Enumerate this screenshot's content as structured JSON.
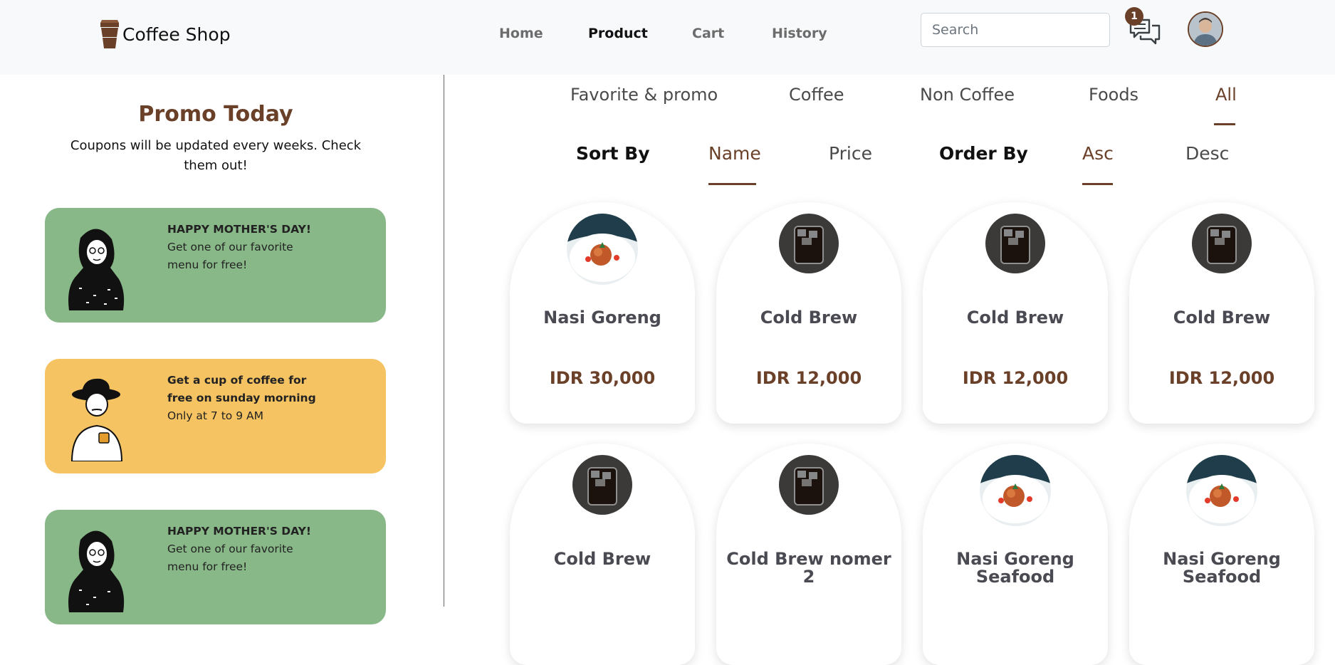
{
  "header": {
    "brand": "Coffee Shop",
    "nav": [
      {
        "label": "Home",
        "active": false
      },
      {
        "label": "Product",
        "active": true
      },
      {
        "label": "Cart",
        "active": false
      },
      {
        "label": "History",
        "active": false
      }
    ],
    "search_placeholder": "Search",
    "chat_badge": "1"
  },
  "promo": {
    "title": "Promo Today",
    "subtitle": "Coupons will be updated every weeks. Check them out!",
    "coupons": [
      {
        "headline": "HAPPY MOTHER'S DAY!",
        "body": "Get one of our favorite menu for free!",
        "color": "#88b788"
      },
      {
        "headline": "Get a cup of coffee for free on sunday morning",
        "body": "Only at 7 to 9 AM",
        "color": "#f5c361"
      },
      {
        "headline": "HAPPY MOTHER'S DAY!",
        "body": "Get one of our favorite menu for free!",
        "color": "#88b788"
      }
    ]
  },
  "categories": [
    {
      "label": "Favorite & promo",
      "active": false
    },
    {
      "label": "Coffee",
      "active": false
    },
    {
      "label": "Non Coffee",
      "active": false
    },
    {
      "label": "Foods",
      "active": false
    },
    {
      "label": "All",
      "active": true
    }
  ],
  "sorting": {
    "sort_label": "Sort By",
    "sort_options": [
      {
        "label": "Name",
        "active": true
      },
      {
        "label": "Price",
        "active": false
      }
    ],
    "order_label": "Order By",
    "order_options": [
      {
        "label": "Asc",
        "active": true
      },
      {
        "label": "Desc",
        "active": false
      }
    ]
  },
  "products": [
    {
      "name": "Nasi Goreng",
      "price": "IDR 30,000",
      "image": "pasta"
    },
    {
      "name": "Cold Brew",
      "price": "IDR 12,000",
      "image": "cold-brew"
    },
    {
      "name": "Cold Brew",
      "price": "IDR 12,000",
      "image": "cold-brew"
    },
    {
      "name": "Cold Brew",
      "price": "IDR 12,000",
      "image": "cold-brew"
    },
    {
      "name": "Cold Brew",
      "price": "",
      "image": "cold-brew"
    },
    {
      "name": "Cold Brew nomer 2",
      "price": "",
      "image": "cold-brew"
    },
    {
      "name": "Nasi Goreng Seafood",
      "price": "",
      "image": "pasta"
    },
    {
      "name": "Nasi Goreng Seafood",
      "price": "",
      "image": "pasta"
    }
  ]
}
